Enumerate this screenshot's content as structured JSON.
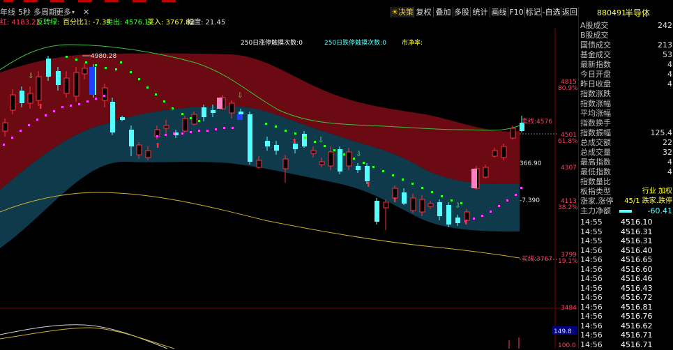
{
  "top_menu": {
    "items": [
      "年线",
      "5秒",
      "多周期",
      "更多"
    ],
    "close_glyph": "✕"
  },
  "toolbar": {
    "buttons": [
      "决策",
      "复权",
      "叠加",
      "多股",
      "统计",
      "画线",
      "F10",
      "标记",
      "-自选",
      "返回"
    ]
  },
  "indicators": {
    "hong": "红: 4183.21",
    "fanzhuan": "反转绿:",
    "baifenbi": "百分比1: -7.39",
    "maichu": "卖出: 4576.12",
    "mairu": "买入: 3767.82",
    "fudu": "幅度: 21.45"
  },
  "chart_labels": {
    "peak_label": "4980.28",
    "limit_touch_1": "250日涨停触摸次数:0",
    "limit_touch_2": "250日跌停触摸次数:0",
    "net_label": "市净率:",
    "sell_line": "卖线:4576",
    "buy_line": "买线:3767",
    "price_level": "366.90",
    "neg_label": "-7.390"
  },
  "axis_labels": [
    "4815",
    "80.9%",
    "4501",
    "61.8%",
    "4307",
    "4113",
    "38.2%",
    "3799",
    "19.1%",
    "3484",
    "149.8",
    "100.0"
  ],
  "right_panel": {
    "code": "880491",
    "name": "半导体",
    "stats": [
      {
        "label": "A股成交",
        "value": "242"
      },
      {
        "label": "B股成交",
        "value": ""
      },
      {
        "label": "国债成交",
        "value": "213"
      },
      {
        "label": "基金成交",
        "value": "53"
      },
      {
        "label": "最新指数",
        "value": "4"
      },
      {
        "label": "今日开盘",
        "value": "4"
      },
      {
        "label": "昨日收盘",
        "value": "4"
      },
      {
        "label": "指数涨跌",
        "value": ""
      },
      {
        "label": "指数涨幅",
        "value": ""
      },
      {
        "label": "平均涨幅",
        "value": ""
      },
      {
        "label": "指数换手",
        "value": ""
      },
      {
        "label": "指数振幅",
        "value": "125.4"
      },
      {
        "label": "总成交额",
        "value": "22"
      },
      {
        "label": "总成交量",
        "value": "32"
      },
      {
        "label": "最高指数",
        "value": "4"
      },
      {
        "label": "最低指数",
        "value": "4"
      },
      {
        "label": "指数量比",
        "value": ""
      },
      {
        "label": "板指类型",
        "value": "行业 加权"
      },
      {
        "label": "涨家.涨停",
        "value": "45/1 跌家.跌停"
      },
      {
        "label": "主力净额",
        "value": "-60.41"
      }
    ],
    "ticks": [
      {
        "time": "14:55",
        "price": "4516.10"
      },
      {
        "time": "14:55",
        "price": "4516.31"
      },
      {
        "time": "14:55",
        "price": "4516.31"
      },
      {
        "time": "14:56",
        "price": "4516.40"
      },
      {
        "time": "14:56",
        "price": "4516.65"
      },
      {
        "time": "14:56",
        "price": "4516.60"
      },
      {
        "time": "14:56",
        "price": "4516.46"
      },
      {
        "time": "14:56",
        "price": "4516.43"
      },
      {
        "time": "14:56",
        "price": "4516.72"
      },
      {
        "time": "14:56",
        "price": "4516.81"
      },
      {
        "time": "14:56",
        "price": "4516.76"
      },
      {
        "time": "14:56",
        "price": "4516.62"
      },
      {
        "time": "14:56",
        "price": "4516.71"
      },
      {
        "time": "14:56",
        "price": "4516.71"
      }
    ]
  },
  "colors": {
    "up": "#ff3040",
    "down": "#54ffff",
    "band_red": "#6b0a12",
    "band_blue": "#103a4e",
    "green_line": "#3cc03c",
    "yellow_line": "#c8b030",
    "purple": "#ff40ff",
    "green_dot": "#30ff30"
  }
}
